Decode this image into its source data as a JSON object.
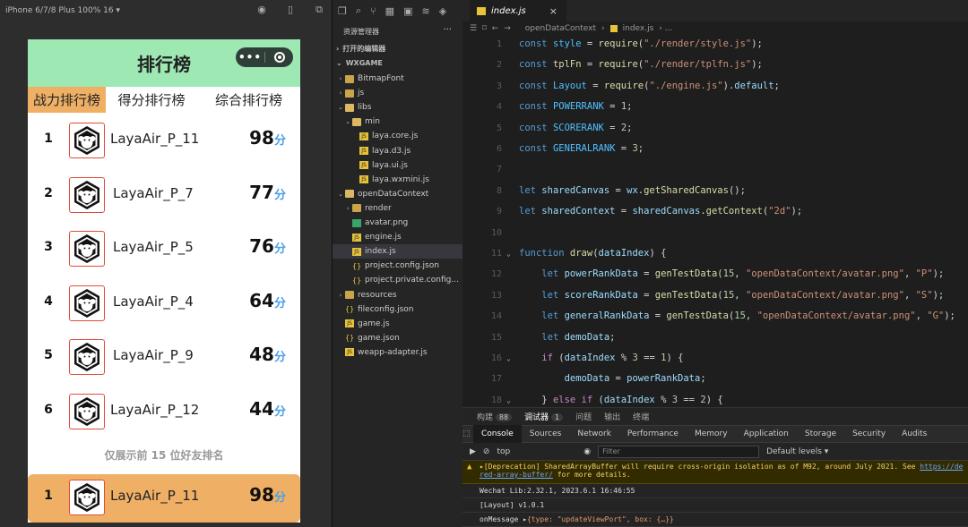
{
  "simulator": {
    "device_label": "iPhone 6/7/8 Plus 100% 16 ▾",
    "toolbar_icons": [
      "record-icon",
      "phone-icon",
      "window-icon"
    ]
  },
  "phone": {
    "title": "排行榜",
    "capsule_dots": "•••",
    "tabs": [
      {
        "label": "战力排行榜",
        "active": true
      },
      {
        "label": "得分排行榜",
        "active": false
      },
      {
        "label": "综合排行榜",
        "active": false
      }
    ],
    "rows": [
      {
        "rank": "1",
        "name": "LayaAir_P_11",
        "score": "98",
        "unit": "分"
      },
      {
        "rank": "2",
        "name": "LayaAir_P_7",
        "score": "77",
        "unit": "分"
      },
      {
        "rank": "3",
        "name": "LayaAir_P_5",
        "score": "76",
        "unit": "分"
      },
      {
        "rank": "4",
        "name": "LayaAir_P_4",
        "score": "64",
        "unit": "分"
      },
      {
        "rank": "5",
        "name": "LayaAir_P_9",
        "score": "48",
        "unit": "分"
      },
      {
        "rank": "6",
        "name": "LayaAir_P_12",
        "score": "44",
        "unit": "分"
      }
    ],
    "footer_note": "仅展示前 15 位好友排名",
    "my_row": {
      "rank": "1",
      "name": "LayaAir_P_11",
      "score": "98",
      "unit": "分"
    }
  },
  "explorer": {
    "title": "资源管理器",
    "more": "···",
    "open_editors": "打开的编辑器",
    "project": "WXGAME",
    "items": [
      {
        "label": "BitmapFont",
        "type": "folder",
        "depth": 1,
        "arrow": "›"
      },
      {
        "label": "js",
        "type": "folder",
        "depth": 1,
        "arrow": "›"
      },
      {
        "label": "libs",
        "type": "folder-open",
        "depth": 1,
        "arrow": "⌄"
      },
      {
        "label": "min",
        "type": "folder-open",
        "depth": 2,
        "arrow": "⌄"
      },
      {
        "label": "laya.core.js",
        "type": "js",
        "depth": 3,
        "arrow": ""
      },
      {
        "label": "laya.d3.js",
        "type": "js",
        "depth": 3,
        "arrow": ""
      },
      {
        "label": "laya.ui.js",
        "type": "js",
        "depth": 3,
        "arrow": ""
      },
      {
        "label": "laya.wxmini.js",
        "type": "js",
        "depth": 3,
        "arrow": ""
      },
      {
        "label": "openDataContext",
        "type": "folder-open",
        "depth": 1,
        "arrow": "⌄"
      },
      {
        "label": "render",
        "type": "folder",
        "depth": 2,
        "arrow": "›"
      },
      {
        "label": "avatar.png",
        "type": "png",
        "depth": 2,
        "arrow": ""
      },
      {
        "label": "engine.js",
        "type": "js",
        "depth": 2,
        "arrow": ""
      },
      {
        "label": "index.js",
        "type": "js",
        "depth": 2,
        "arrow": "",
        "selected": true
      },
      {
        "label": "project.config.json",
        "type": "json",
        "depth": 2,
        "arrow": ""
      },
      {
        "label": "project.private.config...",
        "type": "json",
        "depth": 2,
        "arrow": ""
      },
      {
        "label": "resources",
        "type": "folder",
        "depth": 1,
        "arrow": "›"
      },
      {
        "label": "fileconfig.json",
        "type": "json",
        "depth": 1,
        "arrow": ""
      },
      {
        "label": "game.js",
        "type": "js",
        "depth": 1,
        "arrow": ""
      },
      {
        "label": "game.json",
        "type": "json",
        "depth": 1,
        "arrow": ""
      },
      {
        "label": "weapp-adapter.js",
        "type": "js",
        "depth": 1,
        "arrow": ""
      }
    ]
  },
  "editor": {
    "tab_label": "index.js",
    "tab_close": "×",
    "breadcrumb": [
      "openDataContext",
      "›",
      "index.js",
      "› ..."
    ],
    "lines": [
      {
        "n": "1",
        "html": "<span class='kw'>const</span> <span class='cst'>style</span> = <span class='fn'>require</span>(<span class='st'>\"./render/style.js\"</span>);"
      },
      {
        "n": "2",
        "html": "<span class='kw'>const</span> <span class='fn'>tplFn</span> = <span class='fn'>require</span>(<span class='st'>\"./render/tplfn.js\"</span>);"
      },
      {
        "n": "3",
        "html": "<span class='kw'>const</span> <span class='cst'>Layout</span> = <span class='fn'>require</span>(<span class='st'>\"./engine.js\"</span>).<span class='var'>default</span>;"
      },
      {
        "n": "4",
        "html": "<span class='kw'>const</span> <span class='cst'>POWERRANK</span> = <span class='num'>1</span>;"
      },
      {
        "n": "5",
        "html": "<span class='kw'>const</span> <span class='cst'>SCORERANK</span> = <span class='num'>2</span>;"
      },
      {
        "n": "6",
        "html": "<span class='kw'>const</span> <span class='cst'>GENERALRANK</span> = <span class='num'>3</span>;"
      },
      {
        "n": "7",
        "html": ""
      },
      {
        "n": "8",
        "html": "<span class='kw'>let</span> <span class='var'>sharedCanvas</span> = <span class='var'>wx</span>.<span class='fn'>getSharedCanvas</span>();"
      },
      {
        "n": "9",
        "html": "<span class='kw'>let</span> <span class='var'>sharedContext</span> = <span class='var'>sharedCanvas</span>.<span class='fn'>getContext</span>(<span class='st'>\"2d\"</span>);"
      },
      {
        "n": "10",
        "html": ""
      },
      {
        "n": "11",
        "html": "<span class='kw'>function</span> <span class='fn'>draw</span>(<span class='var'>dataIndex</span>) {",
        "fold": true
      },
      {
        "n": "12",
        "html": "    <span class='kw'>let</span> <span class='var'>powerRankData</span> = <span class='fn'>genTestData</span>(<span class='num'>15</span>, <span class='st'>\"openDataContext/avatar.png\"</span>, <span class='st'>\"P\"</span>);"
      },
      {
        "n": "13",
        "html": "    <span class='kw'>let</span> <span class='var'>scoreRankData</span> = <span class='fn'>genTestData</span>(<span class='num'>15</span>, <span class='st'>\"openDataContext/avatar.png\"</span>, <span class='st'>\"S\"</span>);"
      },
      {
        "n": "14",
        "html": "    <span class='kw'>let</span> <span class='var'>generalRankData</span> = <span class='fn'>genTestData</span>(<span class='num'>15</span>, <span class='st'>\"openDataContext/avatar.png\"</span>, <span class='st'>\"G\"</span>);"
      },
      {
        "n": "15",
        "html": "    <span class='kw'>let</span> <span class='var'>demoData</span>;"
      },
      {
        "n": "16",
        "html": "    <span class='ctl'>if</span> (<span class='var'>dataIndex</span> % <span class='num'>3</span> == <span class='num'>1</span>) {",
        "fold": true
      },
      {
        "n": "17",
        "html": "        <span class='var'>demoData</span> = <span class='var'>powerRankData</span>;"
      },
      {
        "n": "18",
        "html": "    } <span class='ctl'>else if</span> (<span class='var'>dataIndex</span> % <span class='num'>3</span> == <span class='num'>2</span>) {",
        "fold": true
      }
    ]
  },
  "devtools": {
    "tabs1": [
      {
        "label": "构建",
        "badge": "88",
        "active": false
      },
      {
        "label": "调试器",
        "badge": "1",
        "active": true
      },
      {
        "label": "问题",
        "badge": "",
        "active": false
      },
      {
        "label": "输出",
        "badge": "",
        "active": false
      },
      {
        "label": "终端",
        "badge": "",
        "active": false
      }
    ],
    "tabs2": [
      "Console",
      "Sources",
      "Network",
      "Performance",
      "Memory",
      "Application",
      "Storage",
      "Security",
      "Audits"
    ],
    "active_tab2": "Console",
    "context": "top",
    "filter_placeholder": "Filter",
    "levels": "Default levels ▾",
    "warning_text": "▸[Deprecation] SharedArrayBuffer will require cross-origin isolation as of M92, around July 2021. See ",
    "warning_link1": "https://de",
    "warning_link2": "red-array-buffer/",
    "warning_rest": " for more details.",
    "log1": "Wechat Lib:2.32.1, 2023.6.1 16:46:55",
    "log2": "[Layout] v1.0.1",
    "log3_prefix": "onMessage ▸",
    "log3_obj": "{type: \"updateViewPort\", box: {…}}"
  },
  "colors": {
    "header_green": "#9ee8b4",
    "active_orange": "#efb066",
    "score_unit_blue": "#4aa0e8"
  }
}
